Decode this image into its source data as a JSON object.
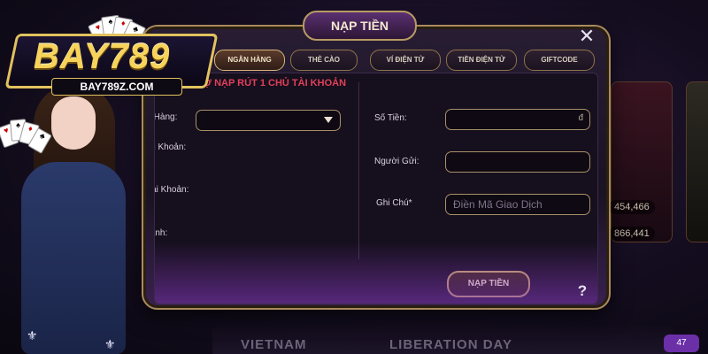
{
  "brand": {
    "logo_text": "BAY789",
    "domain": "BAY789Z.COM"
  },
  "modal": {
    "title": "NẠP TIỀN",
    "tabs": [
      {
        "label": "NGÂN HÀNG",
        "active": true
      },
      {
        "label": "THẺ CÀO",
        "active": false
      },
      {
        "label": "VÍ ĐIỆN TỬ",
        "active": false
      },
      {
        "label": "TIỀN ĐIỆN TỬ",
        "active": false
      },
      {
        "label": "GIFTCODE",
        "active": false
      }
    ],
    "marquee": "TRỢ NẠP RÚT 1 CHỦ TÀI KHOẢN",
    "left_form": {
      "bank_label": "Ngân Hàng:",
      "account_no_label": "Số Tài Khoản:",
      "account_name_label": "Tài Khoản:",
      "branch_label": "Nhánh:"
    },
    "right_form": {
      "amount_label": "Số Tiền:",
      "amount_suffix": "đ",
      "sender_label": "Người Gửi:",
      "note_label": "Ghi Chú*",
      "note_placeholder": "Điền Mã Giao Dịch"
    },
    "submit_label": "NẠP TIỀN",
    "help_label": "?",
    "close_label": "✕"
  },
  "background": {
    "amounts": [
      "454,466",
      "866,441"
    ],
    "banner_words": [
      "VIETNAM",
      "LIBERATION DAY"
    ],
    "badge": "47"
  },
  "colors": {
    "gold_border": "#a98b5c",
    "marquee_red": "#e0405a",
    "purple_glow": "#8c3cc8"
  }
}
